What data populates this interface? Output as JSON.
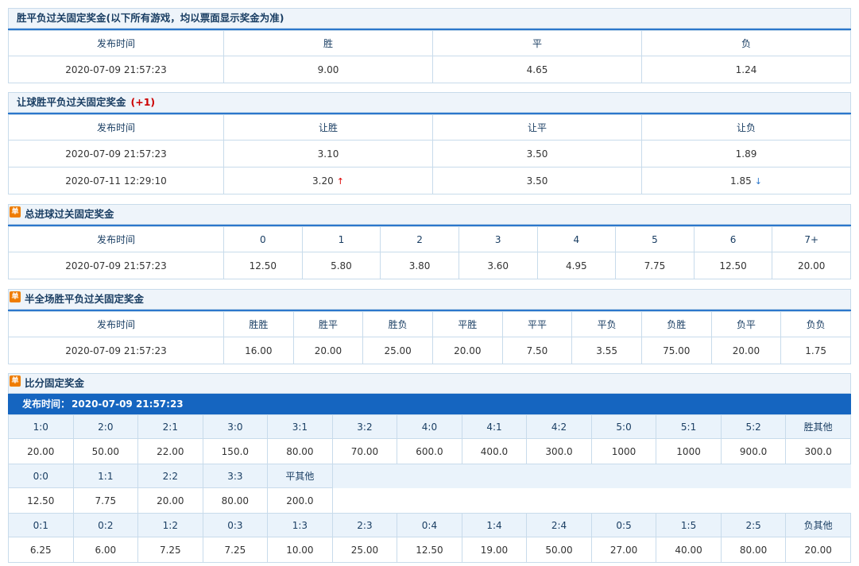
{
  "s1": {
    "title": "胜平负过关固定奖金(以下所有游戏，均以票面显示奖金为准)",
    "headers": [
      "发布时间",
      "胜",
      "平",
      "负"
    ],
    "rows": [
      [
        "2020-07-09 21:57:23",
        "9.00",
        "4.65",
        "1.24"
      ]
    ]
  },
  "s2": {
    "title": "让球胜平负过关固定奖金",
    "handicap": "(+1)",
    "headers": [
      "发布时间",
      "让胜",
      "让平",
      "让负"
    ],
    "rows": [
      [
        "2020-07-09 21:57:23",
        "3.10",
        "3.50",
        "1.89"
      ],
      [
        "2020-07-11 12:29:10",
        "3.20",
        "3.50",
        "1.85"
      ]
    ],
    "up_arrow": "↑",
    "down_arrow": "↓"
  },
  "single_badge": "单",
  "s3": {
    "title": "总进球过关固定奖金",
    "headers": [
      "发布时间",
      "0",
      "1",
      "2",
      "3",
      "4",
      "5",
      "6",
      "7+"
    ],
    "rows": [
      [
        "2020-07-09 21:57:23",
        "12.50",
        "5.80",
        "3.80",
        "3.60",
        "4.95",
        "7.75",
        "12.50",
        "20.00"
      ]
    ]
  },
  "s4": {
    "title": "半全场胜平负过关固定奖金",
    "headers": [
      "发布时间",
      "胜胜",
      "胜平",
      "胜负",
      "平胜",
      "平平",
      "平负",
      "负胜",
      "负平",
      "负负"
    ],
    "rows": [
      [
        "2020-07-09 21:57:23",
        "16.00",
        "20.00",
        "25.00",
        "20.00",
        "7.50",
        "3.55",
        "75.00",
        "20.00",
        "1.75"
      ]
    ]
  },
  "s5": {
    "title": "比分固定奖金",
    "time_label": "发布时间：",
    "time_value": "2020-07-09 21:57:23",
    "win_scores": [
      "1:0",
      "2:0",
      "2:1",
      "3:0",
      "3:1",
      "3:2",
      "4:0",
      "4:1",
      "4:2",
      "5:0",
      "5:1",
      "5:2",
      "胜其他"
    ],
    "win_odds": [
      "20.00",
      "50.00",
      "22.00",
      "150.0",
      "80.00",
      "70.00",
      "600.0",
      "400.0",
      "300.0",
      "1000",
      "1000",
      "900.0",
      "300.0"
    ],
    "draw_scores": [
      "0:0",
      "1:1",
      "2:2",
      "3:3",
      "平其他"
    ],
    "draw_odds": [
      "12.50",
      "7.75",
      "20.00",
      "80.00",
      "200.0"
    ],
    "lose_scores": [
      "0:1",
      "0:2",
      "1:2",
      "0:3",
      "1:3",
      "2:3",
      "0:4",
      "1:4",
      "2:4",
      "0:5",
      "1:5",
      "2:5",
      "负其他"
    ],
    "lose_odds": [
      "6.25",
      "6.00",
      "7.25",
      "7.25",
      "10.00",
      "25.00",
      "12.50",
      "19.00",
      "50.00",
      "27.00",
      "40.00",
      "80.00",
      "20.00"
    ]
  }
}
